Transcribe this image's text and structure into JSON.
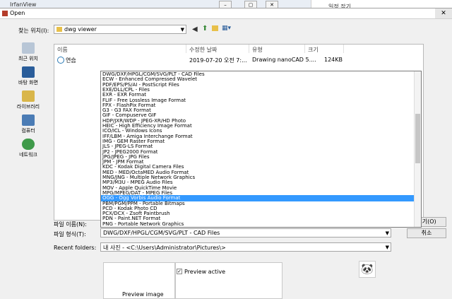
{
  "background_window": {
    "title": "IrfanView",
    "right_panel_text": "일정 잡기"
  },
  "dialog": {
    "title": "Open",
    "look_in_label": "찾는 위치(I):",
    "look_in_value": "dwg viewer",
    "places": [
      {
        "label": "최근 위치",
        "icon": "recent-places-icon",
        "color": "#b8c6d6"
      },
      {
        "label": "바탕 화면",
        "icon": "desktop-icon",
        "color": "#2a5d9a"
      },
      {
        "label": "라이브러리",
        "icon": "libraries-icon",
        "color": "#d9b64a"
      },
      {
        "label": "컴퓨터",
        "icon": "computer-icon",
        "color": "#4b7cb5"
      },
      {
        "label": "네트워크",
        "icon": "network-icon",
        "color": "#3f9a4a"
      }
    ],
    "columns": [
      "이름",
      "수정한 날짜",
      "유형",
      "크기"
    ],
    "files": [
      {
        "name": "연습",
        "modified": "2019-07-20 오전 7:...",
        "type": "Drawing nanoCAD 5....",
        "size": "124KB"
      }
    ],
    "file_name_label": "파일 이름(N):",
    "file_type_label": "파일 형식(T):",
    "file_type_value": "DWG/DXF/HPGL/CGM/SVG/PLT - CAD Files",
    "recent_folders_label": "Recent folders:",
    "recent_folders_value": "내 사진 - <C:\\Users\\Administrator\\Pictures\\>",
    "open_button": "열기(O)",
    "cancel_button": "취소",
    "preview_active_label": "Preview active",
    "preview_image_label": "Preview image",
    "file_types": [
      "DWG/DXF/HPGL/CGM/SVG/PLT - CAD Files",
      "ECW - Enhanced Compressed Wavelet",
      "PDF/EPS/PS/AI - PostScript Files",
      "EXE/DLL/CPL - Files",
      "EXR - EXR Format",
      "FLIF - Free Lossless Image Format",
      "FPX - FlashPix Format",
      "G3 - G3 FAX Format",
      "GIF - Compuserve GIF",
      "HDP/JXR/WDP - JPEG-XR/HD Photo",
      "HEIC - High Efficiency Image Format",
      "ICO/ICL - Windows Icons",
      "IFF/LBM - Amiga Interchange Format",
      "IMG - GEM Raster Format",
      "JLS - JPEG-LS Format",
      "JP2 - JPEG2000 Format",
      "JPG/JPEG - JPG Files",
      "JPM - JPM Format",
      "KDC - Kodak Digital Camera Files",
      "MED - MED/OctaMED Audio Format",
      "MNG/JNG - Multiple Network Graphics",
      "MP3/M3U - MPEG Audio Files",
      "MOV - Apple QuickTime Movie",
      "MPG/MPEG/DAT - MPEG Files",
      "OGG - Ogg Vorbis Audio Format",
      "PBM/PGM/PPM - Portable Bitmaps",
      "PCD - Kodak Photo CD",
      "PCX/DCX - Zsoft Paintbrush",
      "PDN - Paint.NET Format",
      "PNG - Portable Network Graphics"
    ],
    "selected_index": 24
  }
}
